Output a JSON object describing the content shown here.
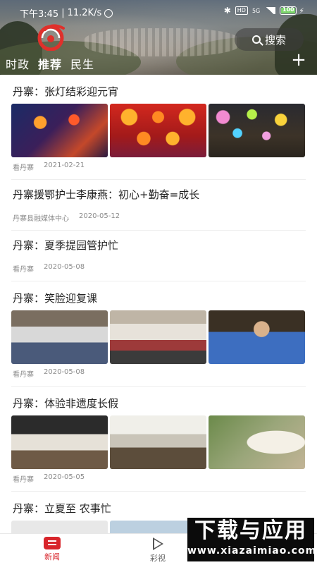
{
  "status_bar": {
    "time": "下午3:45",
    "network_speed": "11.2K/s",
    "signal": "5G",
    "battery": "100",
    "battery_level": 1.0,
    "icons": [
      "alarm-icon",
      "bluetooth-icon",
      "hd-icon",
      "signal-icon",
      "battery-icon",
      "charging-icon"
    ]
  },
  "header": {
    "logo_icon": "logo-icon",
    "search_label": "搜索",
    "search_icon": "search-icon",
    "plus_icon": "plus-icon",
    "tabs": [
      {
        "label": "时政",
        "active": false
      },
      {
        "label": "推荐",
        "active": true
      },
      {
        "label": "民生",
        "active": false
      }
    ]
  },
  "feed": [
    {
      "title": "丹寨：张灯结彩迎元宵",
      "source": "看丹寨",
      "date": "2021-02-21",
      "images": 3
    },
    {
      "title": "丹寨援鄂护士李康燕：初心+勤奋=成长",
      "source": "丹寨县融媒体中心",
      "date": "2020-05-12",
      "images": 0
    },
    {
      "title": "丹寨：夏季提园管护忙",
      "source": "看丹寨",
      "date": "2020-05-08",
      "images": 0
    },
    {
      "title": "丹寨：笑脸迎复课",
      "source": "看丹寨",
      "date": "2020-05-08",
      "images": 3
    },
    {
      "title": "丹寨：体验非遗度长假",
      "source": "看丹寨",
      "date": "2020-05-05",
      "images": 3
    },
    {
      "title": "丹寨：立夏至 农事忙",
      "source": "",
      "date": "",
      "images": 3
    }
  ],
  "bottom_nav": [
    {
      "label": "新闻",
      "icon": "news-icon",
      "active": true
    },
    {
      "label": "彩视",
      "icon": "video-play-icon",
      "active": false
    }
  ],
  "watermark": {
    "title": "下载与应用",
    "url": "www.xiazaimiao.com"
  },
  "colors": {
    "accent": "#d8252b",
    "meta_text": "#8b8b8b",
    "title_text": "#222222"
  }
}
